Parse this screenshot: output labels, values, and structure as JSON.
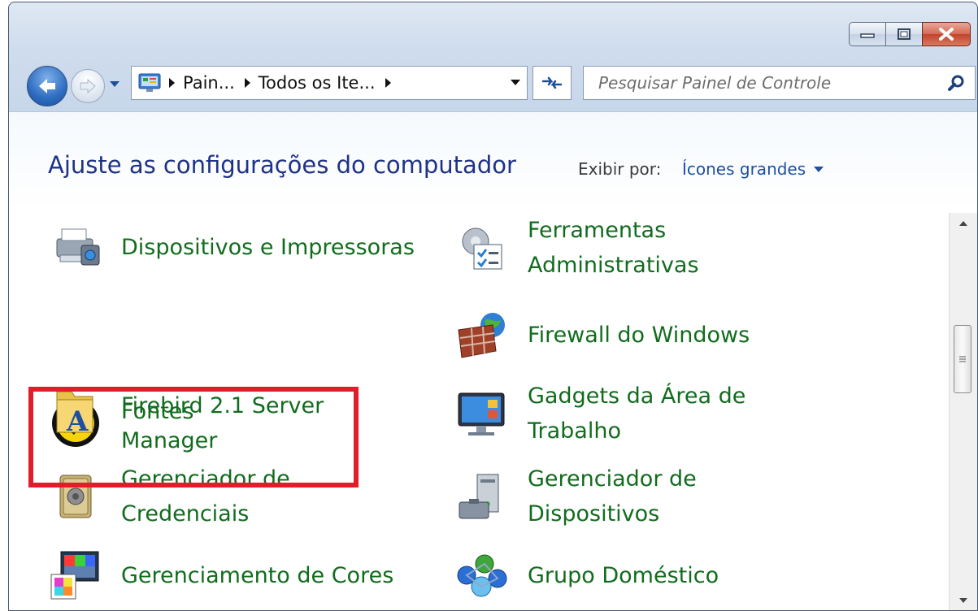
{
  "window": {
    "caption": {
      "minimize": "minimize-icon",
      "maximize": "maximize-icon",
      "close": "close-icon"
    }
  },
  "navbar": {
    "back": "back-arrow-icon",
    "forward": "forward-arrow-icon",
    "breadcrumbs": [
      "Pain...",
      "Todos os Ite..."
    ],
    "search_placeholder": "Pesquisar Painel de Controle"
  },
  "content": {
    "title": "Ajuste as configurações do computador",
    "view_by_label": "Exibir por:",
    "view_by_value": "Ícones grandes"
  },
  "items": [
    {
      "label": "Dispositivos e Impressoras",
      "icon": "devices-printers-icon"
    },
    {
      "label": "Ferramentas Administrativas",
      "icon": "admin-tools-icon"
    },
    {
      "label": "Firebird 2.1 Server Manager",
      "icon": "firebird-icon"
    },
    {
      "label": "Firewall do Windows",
      "icon": "firewall-icon"
    },
    {
      "label": "Fontes",
      "icon": "fonts-folder-icon"
    },
    {
      "label": "Gadgets da Área de Trabalho",
      "icon": "gadgets-icon"
    },
    {
      "label": "Gerenciador de Credenciais",
      "icon": "credential-vault-icon"
    },
    {
      "label": "Gerenciador de Dispositivos",
      "icon": "device-manager-icon"
    },
    {
      "label": "Gerenciamento de Cores",
      "icon": "color-management-icon"
    },
    {
      "label": "Grupo Doméstico",
      "icon": "homegroup-icon"
    }
  ],
  "colors": {
    "link": "#126c1e",
    "title": "#1e3287",
    "highlight": "#e21d2a"
  }
}
